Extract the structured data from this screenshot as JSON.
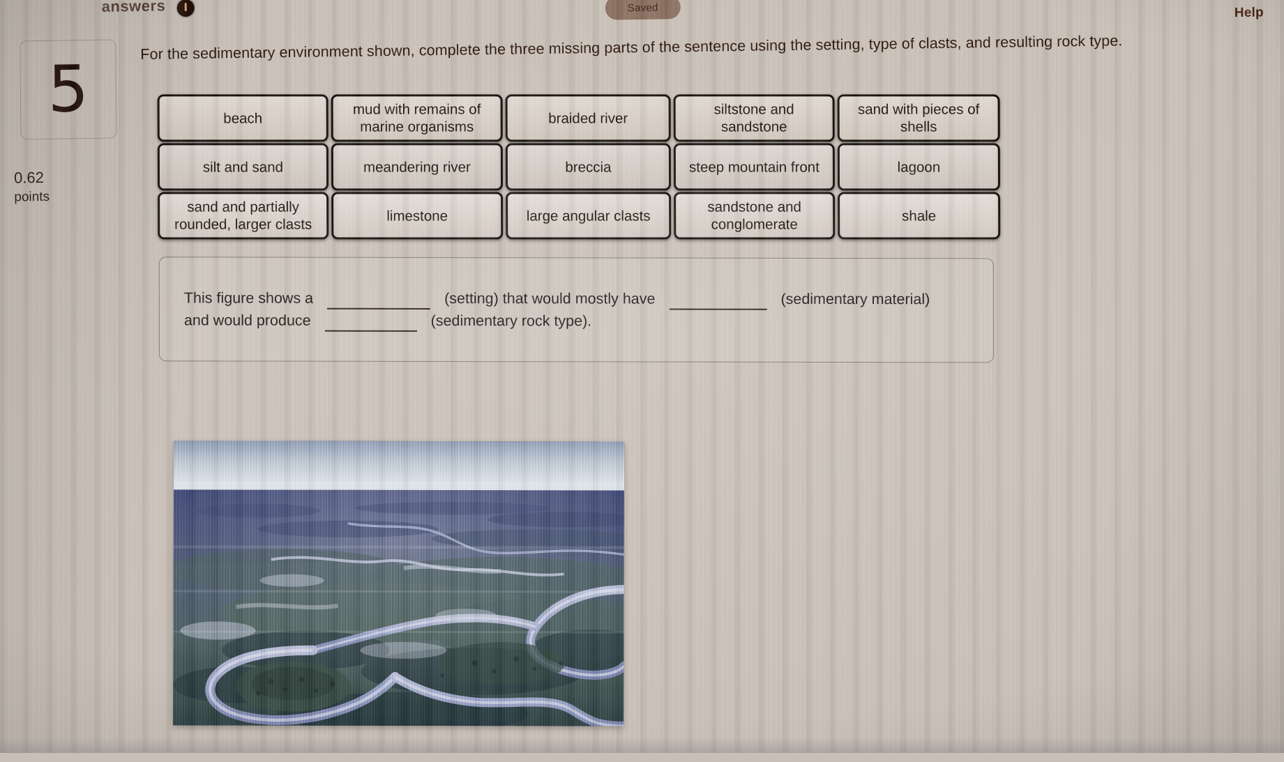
{
  "header": {
    "partial_title": "answers",
    "saved_badge": "Saved",
    "help_label": "Help",
    "status_icon": "info-circle-icon"
  },
  "question": {
    "number": "5",
    "points_value": "0.62",
    "points_label": "points",
    "prompt": "For the sedimentary environment shown, complete the three missing parts of the sentence using the setting, type of clasts, and resulting rock type."
  },
  "word_bank": {
    "tiles": [
      {
        "label": "beach"
      },
      {
        "label": "mud with remains of marine organisms"
      },
      {
        "label": "braided river"
      },
      {
        "label": "siltstone and sandstone"
      },
      {
        "label": "sand with pieces of shells"
      },
      {
        "label": "silt and sand"
      },
      {
        "label": "meandering river"
      },
      {
        "label": "breccia"
      },
      {
        "label": "steep mountain front"
      },
      {
        "label": "lagoon"
      },
      {
        "label": "sand and partially rounded, larger clasts"
      },
      {
        "label": "limestone"
      },
      {
        "label": "large angular clasts"
      },
      {
        "label": "sandstone and conglomerate"
      },
      {
        "label": "shale"
      }
    ]
  },
  "answer_area": {
    "text_1": "This figure shows a",
    "blank_1_value": "",
    "text_2": "(setting) that would mostly have",
    "blank_2_value": "",
    "text_3": "(sedimentary material)",
    "text_4": "and would produce",
    "blank_3_value": "",
    "text_5": "(sedimentary rock type)."
  },
  "figure": {
    "caption": "aerial-photograph-meandering-river",
    "description": "Aerial photograph of a meandering river with large looping bends, point bars and oxbows across a flat green floodplain"
  },
  "colors": {
    "page_warm": "#c8905f",
    "page_cool": "#c3c2c5",
    "tile_border": "#130c08",
    "text": "#1c120c",
    "help_text": "#4b2413"
  }
}
